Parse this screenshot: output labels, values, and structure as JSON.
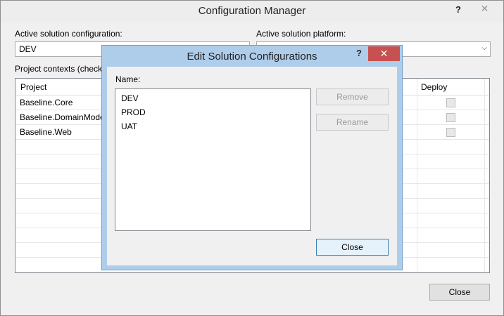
{
  "window": {
    "title": "Configuration Manager",
    "help_glyph": "?",
    "close_glyph": "✕"
  },
  "config": {
    "active_config_label": "Active solution configuration:",
    "active_config_value": "DEV",
    "active_platform_label": "Active solution platform:",
    "project_contexts_label": "Project contexts (check"
  },
  "grid": {
    "headers": {
      "project": "Project",
      "deploy": "Deploy"
    },
    "rows": [
      "Baseline.Core",
      "Baseline.DomainMode",
      "Baseline.Web"
    ]
  },
  "main_close_label": "Close",
  "dialog": {
    "title": "Edit Solution Configurations",
    "help_glyph": "?",
    "close_glyph": "✕",
    "name_label": "Name:",
    "items": [
      "DEV",
      "PROD",
      "UAT"
    ],
    "remove_label": "Remove",
    "rename_label": "Rename",
    "close_label": "Close"
  }
}
